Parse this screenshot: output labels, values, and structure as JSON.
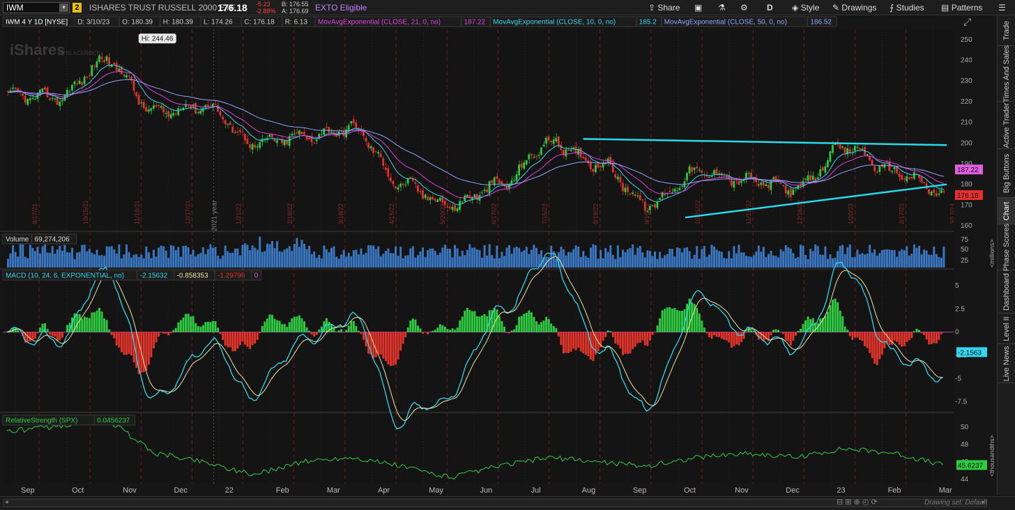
{
  "toolbar": {
    "symbol": "IWM",
    "link_badge": "2",
    "description": "ISHARES TRUST RUSSELL 2000 ETF",
    "last": "176.18",
    "change": "-5.23",
    "change_pct": "-2.88%",
    "bid": "B: 176.55",
    "ask": "A: 176.69",
    "exto": "EXTO Eligible",
    "share": "Share",
    "style": "Style",
    "drawings": "Drawings",
    "studies": "Studies",
    "patterns": "Patterns",
    "aggregation": "D"
  },
  "price_pane": {
    "chart_title": "IWM 4 Y 1D [NYSE]",
    "ohlc": [
      "D: 3/10/23",
      "O: 180.39",
      "H: 180.39",
      "L: 174.26",
      "C: 176.18",
      "R: 6.13"
    ],
    "studies": [
      {
        "label": "MovAvgExponential (CLOSE, 21, 0, no)",
        "value": "187.22",
        "color": "#e040e0"
      },
      {
        "label": "MovAvgExponential (CLOSE, 10, 0, no)",
        "value": "185.2",
        "color": "#33d6ee"
      },
      {
        "label": "MovAvgExponential (CLOSE, 50, 0, no)",
        "value": "186.52",
        "color": "#8fa6ff"
      }
    ],
    "hi_label": "Hi: 244.46",
    "watermark": "iShares",
    "watermark_sub": "by BLACKROCK",
    "year_label": "2021 year",
    "y_ticks": [
      "250",
      "240",
      "230",
      "220",
      "210",
      "200",
      "190",
      "180",
      "170",
      "160"
    ],
    "price_tag_ema": "187.22",
    "price_tag_last": "176.18",
    "expiry_labels": [
      "9/17/21",
      "10/15/21",
      "11/19/21",
      "12/17/21",
      "1/21/22",
      "2/18/22",
      "3/18/22",
      "4/15/22",
      "5/20/22",
      "6/17/22",
      "7/15/22",
      "8/19/22",
      "9/16/22",
      "10/21/22",
      "11/18/22",
      "12/16/22",
      "1/20/23",
      "2/17/23",
      "3/17/23"
    ]
  },
  "volume_pane": {
    "label": "Volume",
    "value": "69,274,206",
    "y_ticks": [
      "75",
      "50",
      "25"
    ],
    "unit": "<millions>"
  },
  "macd_pane": {
    "label": "MACD (10, 24, 6, EXPONENTIAL, no)",
    "values": [
      "-2.15632",
      "-0.858353",
      "-1.29796",
      "0"
    ],
    "y_ticks": [
      "5",
      "2.5",
      "0",
      "-2.5",
      "-5",
      "-7.5"
    ],
    "tag": "-2.1563"
  },
  "rs_pane": {
    "label": "RelativeStrength (SPX)",
    "value": "0.0456237",
    "y_ticks": [
      "50",
      "48",
      "46",
      "44"
    ],
    "tag": "45.6237",
    "unit": "<thousandths>"
  },
  "x_axis": [
    "Sep",
    "Oct",
    "Nov",
    "Dec",
    "22",
    "Feb",
    "Mar",
    "Apr",
    "May",
    "Jun",
    "Jul",
    "Aug",
    "Sep",
    "Oct",
    "Nov",
    "Dec",
    "23",
    "Feb",
    "Mar"
  ],
  "sidebar_tabs": [
    "Trade",
    "Times And Sales",
    "Active Trader",
    "Big Buttons",
    "Chart",
    "Phase Scores",
    "Dashboard",
    "Level II",
    "Live News"
  ],
  "footer": {
    "drawing_set": "Drawing set: Default"
  },
  "chart_data": {
    "type": "candlestick",
    "title": "IWM 4 Y 1D [NYSE]",
    "months": [
      "Sep",
      "Oct",
      "Nov",
      "Dec",
      "22",
      "Feb",
      "Mar",
      "Apr",
      "May",
      "Jun",
      "Jul",
      "Aug",
      "Sep",
      "Oct",
      "Nov",
      "Dec",
      "23",
      "Feb",
      "Mar"
    ],
    "close_approx": [
      223,
      222,
      240,
      215,
      218,
      200,
      203,
      207,
      180,
      170,
      180,
      200,
      190,
      170,
      186,
      182,
      178,
      198,
      186,
      176
    ],
    "ylim": [
      158,
      255
    ],
    "hi": 244.46,
    "last": 176.18,
    "trendlines": [
      {
        "from": [
          "Aug-22",
          202
        ],
        "to": [
          "Mar-23",
          199
        ]
      },
      {
        "from": [
          "Oct-22",
          164
        ],
        "to": [
          "Mar-23",
          180
        ]
      }
    ],
    "macd": {
      "ylim": [
        -8.5,
        6.5
      ],
      "last": -2.15632
    },
    "relative_strength": {
      "ylim": [
        43.5,
        51.5
      ],
      "last": 45.6237
    },
    "colors": {
      "up": "#2ecc40",
      "down": "#e5342a",
      "ema10": "#33d6ee",
      "ema21": "#e040e0",
      "ema50": "#8fa6ff",
      "trendline": "#27dbe8",
      "volume": "#3b78c4",
      "rs": "#2ecc40"
    }
  }
}
